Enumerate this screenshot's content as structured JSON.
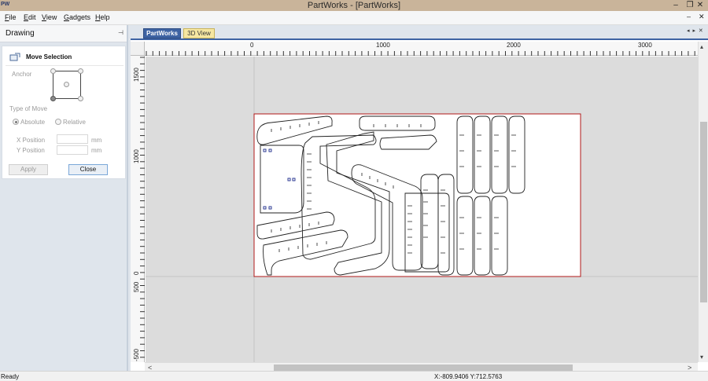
{
  "window": {
    "app_icon": "PW",
    "title": "PartWorks - [PartWorks]",
    "minimize": "–",
    "maximize": "❐",
    "close": "✕"
  },
  "menu": {
    "items": [
      {
        "key": "F",
        "rest": "ile"
      },
      {
        "key": "E",
        "rest": "dit"
      },
      {
        "key": "V",
        "rest": "iew"
      },
      {
        "key": "G",
        "rest": "adgets"
      },
      {
        "key": "H",
        "rest": "elp"
      }
    ],
    "mdi_minimize": "–",
    "mdi_close": "✕"
  },
  "drawing_panel": {
    "title": "Drawing",
    "pin_icon": "⊣",
    "move_selection": {
      "title": "Move Selection",
      "anchor_label": "Anchor",
      "type_of_move_label": "Type of Move",
      "absolute_label": "Absolute",
      "relative_label": "Relative",
      "selected_move_type": "absolute",
      "x_label": "X Position",
      "y_label": "Y Position",
      "x_value": "",
      "y_value": "",
      "unit": "mm",
      "apply_label": "Apply",
      "close_label": "Close"
    }
  },
  "tabs": [
    {
      "label": "PartWorks",
      "active": true
    },
    {
      "label": "3D View",
      "active": false
    }
  ],
  "tab_nav": "◂ ▸ ✕",
  "rulers": {
    "top_labels": [
      "0",
      "1000",
      "2000",
      "3000"
    ],
    "left_labels": [
      "1500",
      "1000",
      "500",
      "0",
      "-500"
    ]
  },
  "scrollbars": {
    "up": "▴",
    "down": "▾",
    "left": "<",
    "right": ">"
  },
  "status": {
    "text": "Ready",
    "coordinates": "X:-809.9406 Y:712.5763"
  },
  "colors": {
    "accent": "#3e63a3",
    "tab_inactive": "#f6e7a2",
    "material_border": "#b01818",
    "part_stroke": "#222222",
    "background": "#dfe5ec"
  }
}
